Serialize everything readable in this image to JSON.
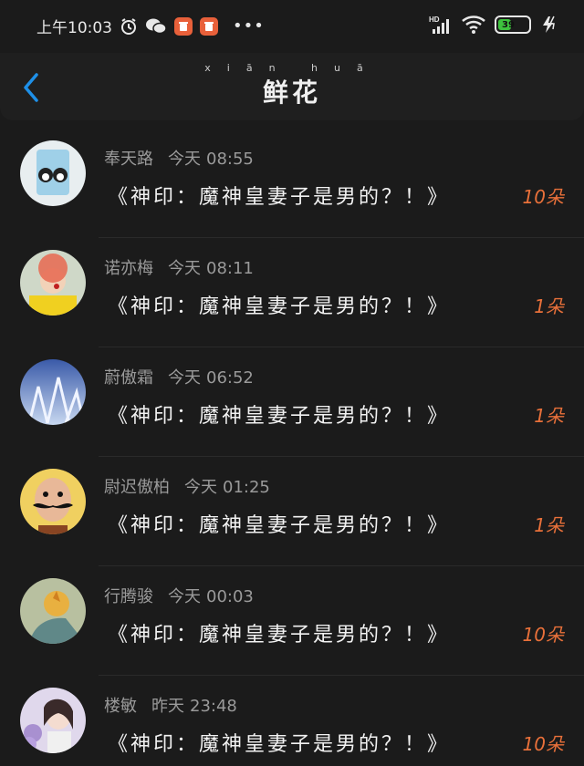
{
  "status_bar": {
    "time": "上午10:03",
    "network": "HD",
    "battery": "39",
    "battery_level": 0.39
  },
  "header": {
    "title": "鲜花",
    "title_pinyin": "xiān huā"
  },
  "list": [
    {
      "name": "奉天路",
      "date": "今天",
      "time": "08:55",
      "book": "《神印：魔神皇妻子是男的？！》",
      "count": "10朵"
    },
    {
      "name": "诺亦梅",
      "date": "今天",
      "time": "08:11",
      "book": "《神印：魔神皇妻子是男的？！》",
      "count": "1朵"
    },
    {
      "name": "蔚傲霜",
      "date": "今天",
      "time": "06:52",
      "book": "《神印：魔神皇妻子是男的？！》",
      "count": "1朵"
    },
    {
      "name": "尉迟傲柏",
      "date": "今天",
      "time": "01:25",
      "book": "《神印：魔神皇妻子是男的？！》",
      "count": "1朵"
    },
    {
      "name": "行腾骏",
      "date": "今天",
      "time": "00:03",
      "book": "《神印：魔神皇妻子是男的？！》",
      "count": "10朵"
    },
    {
      "name": "楼敏",
      "date": "昨天",
      "time": "23:48",
      "book": "《神印：魔神皇妻子是男的？！》",
      "count": "10朵"
    }
  ]
}
